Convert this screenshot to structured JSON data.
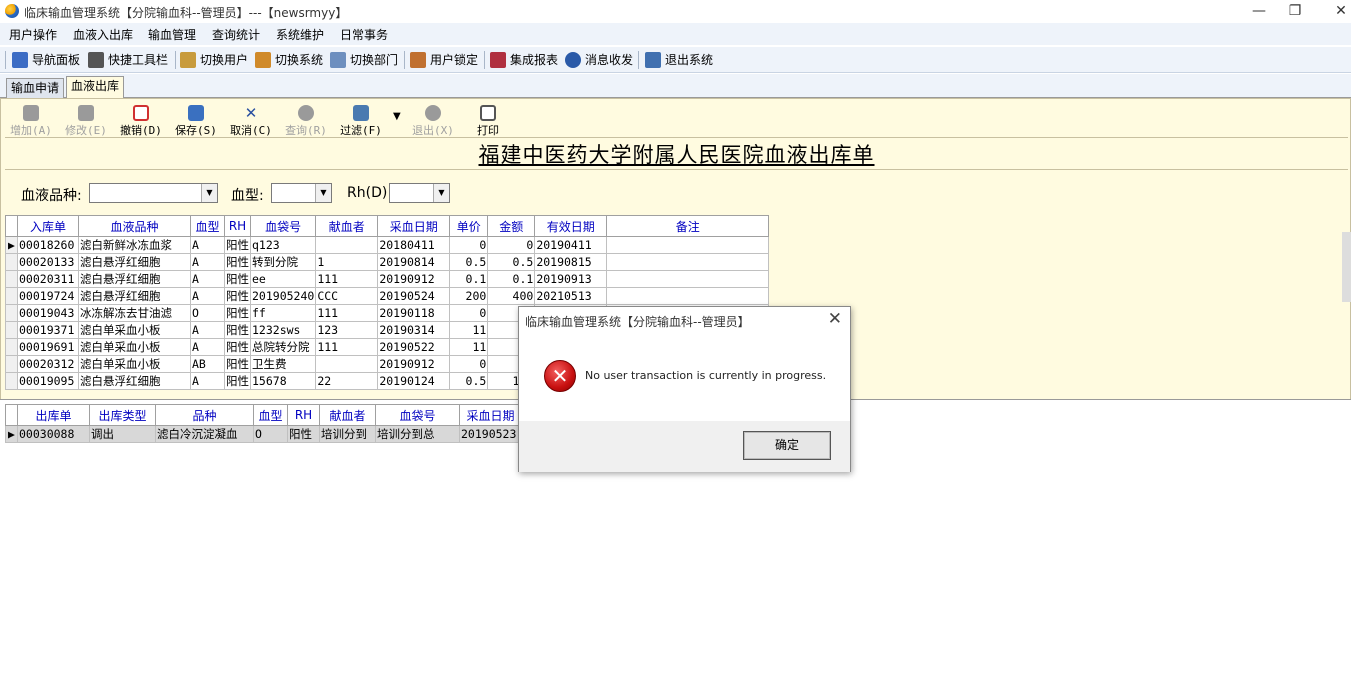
{
  "window": {
    "title": "临床输血管理系统【分院输血科--管理员】---【newsrmyy】",
    "min": "—",
    "restore": "❐",
    "close": "✕"
  },
  "menu": [
    "用户操作",
    "血液入出库",
    "输血管理",
    "查询统计",
    "系统维护",
    "日常事务"
  ],
  "toolbar": [
    {
      "label": "导航面板",
      "icon": "navigation-panel-icon",
      "color": "#3b6cc4"
    },
    {
      "label": "快捷工具栏",
      "icon": "quick-toolbar-icon",
      "color": "#555555"
    },
    {
      "label": "切换用户",
      "icon": "switch-user-icon",
      "color": "#c89b3c"
    },
    {
      "label": "切换系统",
      "icon": "switch-system-icon",
      "color": "#d08a2a"
    },
    {
      "label": "切换部门",
      "icon": "switch-dept-icon",
      "color": "#6d8fbf"
    },
    {
      "label": "用户锁定",
      "icon": "user-lock-icon",
      "color": "#c07030"
    },
    {
      "label": "集成报表",
      "icon": "report-icon",
      "color": "#b03040"
    },
    {
      "label": "消息收发",
      "icon": "message-icon",
      "color": "#2a5aa8"
    },
    {
      "label": "退出系统",
      "icon": "exit-system-icon",
      "color": "#4070b0"
    }
  ],
  "tabs": [
    "输血申请",
    "血液出库"
  ],
  "form_buttons": [
    {
      "label": "增加(A)",
      "icon": "add-icon",
      "disabled": true,
      "color": "#9a9a9a"
    },
    {
      "label": "修改(E)",
      "icon": "edit-icon",
      "disabled": true,
      "color": "#9a9a9a"
    },
    {
      "label": "撤销(D)",
      "icon": "undo-delete-icon",
      "disabled": false,
      "color": "#d03030"
    },
    {
      "label": "保存(S)",
      "icon": "save-icon",
      "disabled": false,
      "color": "#3a70c0"
    },
    {
      "label": "取消(C)",
      "icon": "cancel-icon",
      "disabled": false,
      "color": "#2a50a0"
    },
    {
      "label": "查询(R)",
      "icon": "query-icon",
      "disabled": true,
      "color": "#9a9a9a"
    },
    {
      "label": "过滤(F)",
      "icon": "filter-icon",
      "disabled": false,
      "color": "#4a7ab0"
    },
    {
      "label": "退出(X)",
      "icon": "exit-icon",
      "disabled": true,
      "color": "#9a9a9a"
    },
    {
      "label": "打印",
      "icon": "print-icon",
      "disabled": false,
      "color": "#555555"
    }
  ],
  "filter_dropdown_arrow": "▼",
  "doc_title": "福建中医药大学附属人民医院血液出库单",
  "filters": {
    "product_label": "血液品种:",
    "bloodtype_label": "血型:",
    "rh_label": "Rh(D)",
    "arrow": "▼"
  },
  "grid1": {
    "columns": [
      "入库单",
      "血液品种",
      "血型",
      "RH",
      "血袋号",
      "献血者",
      "采血日期",
      "单价",
      "金额",
      "有效日期",
      "备注"
    ],
    "rows": [
      [
        "00018260",
        "滤白新鲜冰冻血浆",
        "A",
        "阳性",
        "q123",
        "",
        "20180411",
        "0",
        "0",
        "20190411",
        ""
      ],
      [
        "00020133",
        "滤白悬浮红细胞",
        "A",
        "阳性",
        "转到分院",
        "1",
        "20190814",
        "0.5",
        "0.5",
        "20190815",
        ""
      ],
      [
        "00020311",
        "滤白悬浮红细胞",
        "A",
        "阳性",
        "ee",
        "111",
        "20190912",
        "0.1",
        "0.1",
        "20190913",
        ""
      ],
      [
        "00019724",
        "滤白悬浮红细胞",
        "A",
        "阳性",
        "201905240",
        "CCC",
        "20190524",
        "200",
        "400",
        "20210513",
        ""
      ],
      [
        "00019043",
        "冰冻解冻去甘油滤",
        "O",
        "阳性",
        "ff",
        "111",
        "20190118",
        "0",
        "",
        "",
        ""
      ],
      [
        "00019371",
        "滤白单采血小板",
        "A",
        "阳性",
        "1232sws",
        "123",
        "20190314",
        "11",
        "1",
        "",
        ""
      ],
      [
        "00019691",
        "滤白单采血小板",
        "A",
        "阳性",
        "总院转分院",
        "111",
        "20190522",
        "11",
        "2",
        "",
        ""
      ],
      [
        "00020312",
        "滤白单采血小板",
        "AB",
        "阳性",
        "卫生费",
        "",
        "20190912",
        "0",
        "",
        "",
        ""
      ],
      [
        "00019095",
        "滤白悬浮红细胞",
        "A",
        "阳性",
        "15678",
        "22",
        "20190124",
        "0.5",
        "11.",
        "",
        ""
      ]
    ],
    "current_row_marker": "▶"
  },
  "grid2": {
    "columns": [
      "出库单",
      "出库类型",
      "品种",
      "血型",
      "RH",
      "献血者",
      "血袋号",
      "采血日期"
    ],
    "rows": [
      [
        "00030088",
        "调出",
        "滤白冷沉淀凝血",
        "O",
        "阳性",
        "培训分到",
        "培训分到总",
        "20190523"
      ]
    ],
    "current_row_marker": "▶"
  },
  "dialog": {
    "title": "临床输血管理系统【分院输血科--管理员】",
    "close": "✕",
    "error_glyph": "✕",
    "message": "No user transaction is currently in progress.",
    "ok_label": "确定"
  }
}
